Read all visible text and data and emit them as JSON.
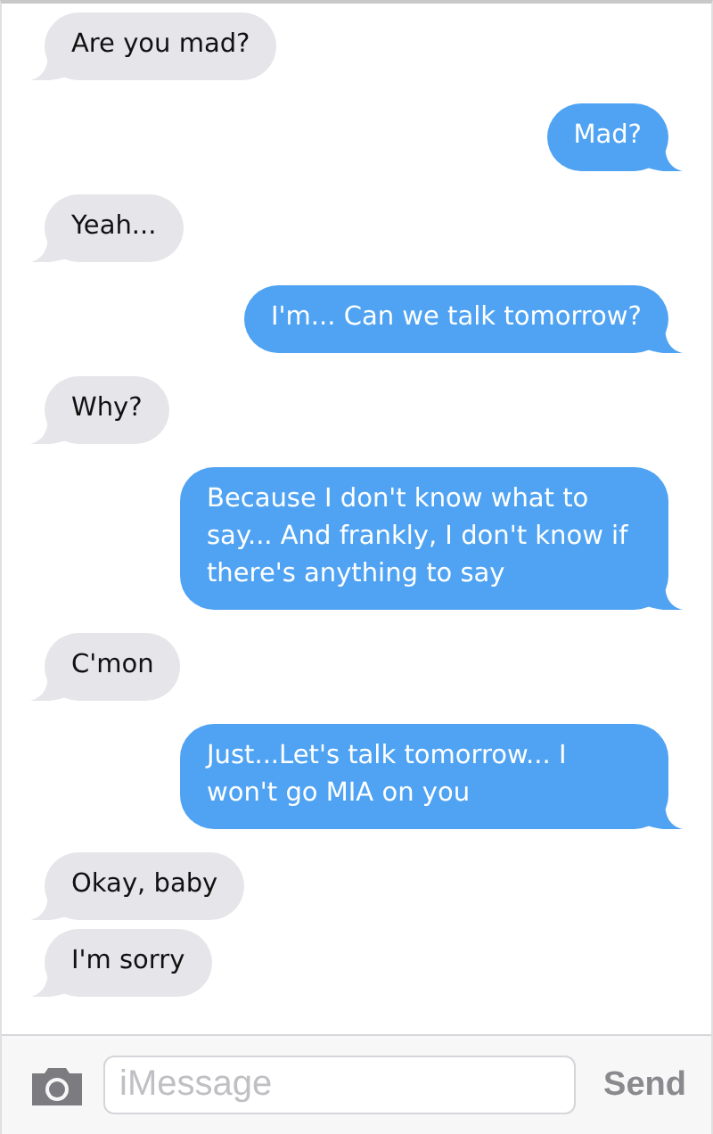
{
  "messages": [
    {
      "kind": "incoming",
      "text": "Are you mad?"
    },
    {
      "kind": "outgoing",
      "text": "Mad?"
    },
    {
      "kind": "incoming",
      "text": "Yeah..."
    },
    {
      "kind": "outgoing",
      "text": "I'm... Can we talk tomorrow?"
    },
    {
      "kind": "incoming",
      "text": "Why?"
    },
    {
      "kind": "outgoing",
      "text": "Because I don't know what to say... And frankly, I don't know if there's anything to say"
    },
    {
      "kind": "incoming",
      "text": "C'mon"
    },
    {
      "kind": "outgoing",
      "text": "Just...Let's talk tomorrow... I won't go MIA on you"
    },
    {
      "kind": "incoming",
      "text": "Okay, baby"
    },
    {
      "kind": "incoming",
      "text": "I'm sorry"
    }
  ],
  "compose": {
    "placeholder": "iMessage",
    "send": "Send"
  }
}
